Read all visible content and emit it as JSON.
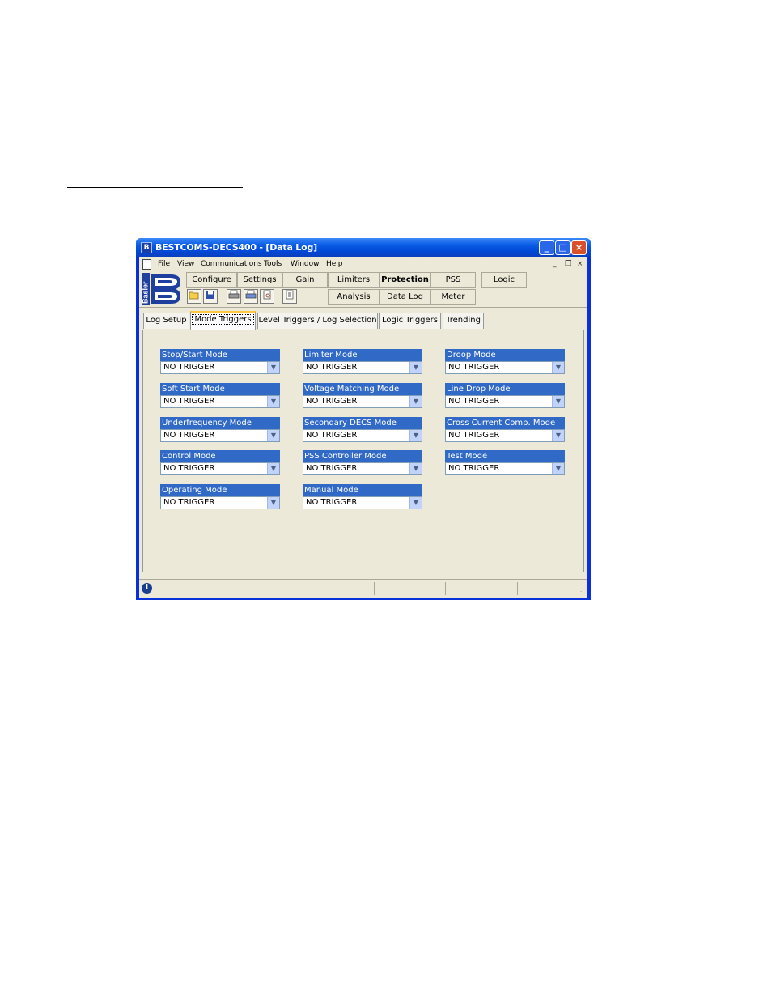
{
  "window": {
    "title": "BESTCOMS-DECS400 - [Data Log]",
    "icon": "b-logo-icon"
  },
  "menu": [
    "File",
    "View",
    "Communications",
    "Tools",
    "Window",
    "Help"
  ],
  "mdi_controls": [
    "_",
    "ə",
    "×"
  ],
  "logo_text": "Basler",
  "nav_row1": [
    "Configure",
    "Settings",
    "Gain",
    "Limiters",
    "Protection",
    "PSS",
    "Logic"
  ],
  "nav_row2": [
    "Analysis",
    "Data Log",
    "Meter"
  ],
  "toolbar_icons": [
    "open-folder-icon",
    "save-icon",
    "print-icon",
    "print-preview-icon",
    "preview-icon",
    "notes-icon"
  ],
  "tabs": [
    "Log Setup",
    "Mode Triggers",
    "Level Triggers / Log Selection",
    "Logic Triggers",
    "Trending"
  ],
  "active_tab": "Mode Triggers",
  "fields": [
    {
      "label": "Stop/Start Mode",
      "value": "NO TRIGGER"
    },
    {
      "label": "Limiter Mode",
      "value": "NO TRIGGER"
    },
    {
      "label": "Droop Mode",
      "value": "NO TRIGGER"
    },
    {
      "label": "Soft Start Mode",
      "value": "NO TRIGGER"
    },
    {
      "label": "Voltage Matching Mode",
      "value": "NO TRIGGER"
    },
    {
      "label": "Line Drop Mode",
      "value": "NO TRIGGER"
    },
    {
      "label": "Underfrequency Mode",
      "value": "NO TRIGGER"
    },
    {
      "label": "Secondary DECS Mode",
      "value": "NO TRIGGER"
    },
    {
      "label": "Cross Current Comp. Mode",
      "value": "NO TRIGGER"
    },
    {
      "label": "Control Mode",
      "value": "NO TRIGGER"
    },
    {
      "label": "PSS Controller Mode",
      "value": "NO TRIGGER"
    },
    {
      "label": "Test Mode",
      "value": "NO TRIGGER"
    },
    {
      "label": "Operating Mode",
      "value": "NO TRIGGER"
    },
    {
      "label": "Manual Mode",
      "value": "NO TRIGGER"
    }
  ],
  "colors": {
    "titlebar": "#0a5ce6",
    "field_label_bg": "#3169c6",
    "window_bg": "#ece9d8"
  }
}
